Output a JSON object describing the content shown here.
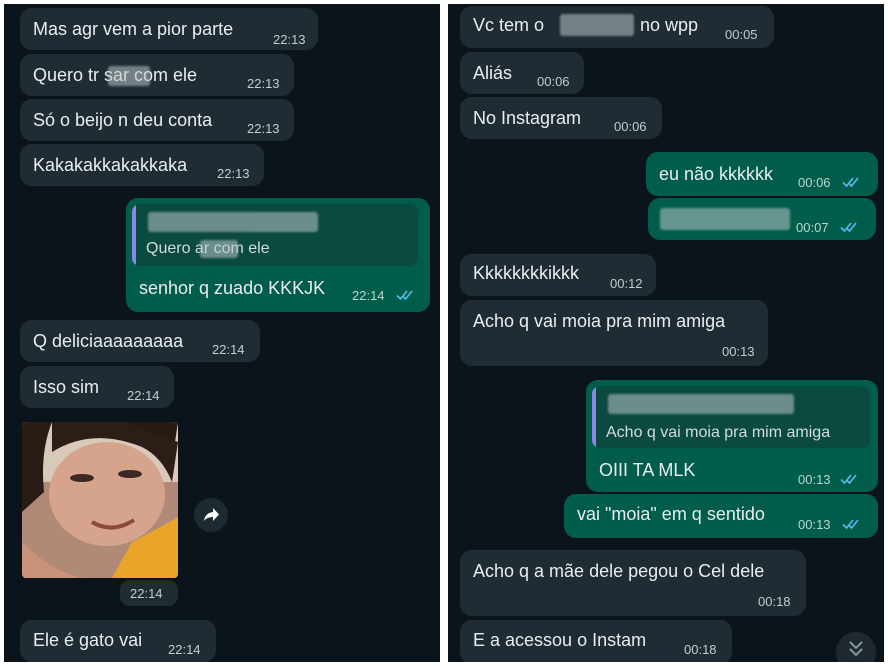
{
  "left_chat": {
    "messages": [
      {
        "text": "Mas agr vem a pior parte",
        "time": "22:13"
      },
      {
        "text": "Quero tr     sar com ele",
        "time": "22:13"
      },
      {
        "text": "Só o beijo n deu conta",
        "time": "22:13"
      },
      {
        "text": "Kakakakkakakkaka",
        "time": "22:13"
      },
      {
        "reply_quote": "Quero      ar com ele",
        "text": "senhor q zuado KKKJK",
        "time": "22:14"
      },
      {
        "text": "Q deliciaaaaaaaaa",
        "time": "22:14"
      },
      {
        "text": "Isso sim",
        "time": "22:14"
      },
      {
        "image_time": "22:14"
      },
      {
        "text": "Ele é gato vai",
        "time": "22:14"
      }
    ]
  },
  "right_chat": {
    "messages": [
      {
        "text_start": "Vc tem o",
        "text_end": "no wpp",
        "time": "00:05"
      },
      {
        "text": "Aliás",
        "time": "00:06"
      },
      {
        "text": "No Instagram",
        "time": "00:06"
      },
      {
        "text": "eu não kkkkkk",
        "time": "00:06"
      },
      {
        "time": "00:07"
      },
      {
        "text": "Kkkkkkkkikkk",
        "time": "00:12"
      },
      {
        "text": "Acho q vai moia pra mim amiga",
        "time": "00:13"
      },
      {
        "reply_quote": "Acho q vai moia pra mim amiga",
        "text": "OIII TA MLK",
        "time": "00:13"
      },
      {
        "text": "vai \"moia\" em q sentido",
        "time": "00:13"
      },
      {
        "text": "Acho q a mãe dele pegou o Cel dele",
        "time": "00:18"
      },
      {
        "text": "E a acessou o Instam",
        "time": "00:18"
      }
    ]
  },
  "icons": {
    "read_ticks": "double-check-icon",
    "forward": "forward-arrow-icon",
    "scroll_down": "chevron-double-down-icon"
  },
  "colors": {
    "background": "#0c141b",
    "incoming_bubble": "#202c33",
    "outgoing_bubble": "#005c4b",
    "read_ticks": "#53bdeb",
    "quote_bar": "#8b86e6"
  }
}
